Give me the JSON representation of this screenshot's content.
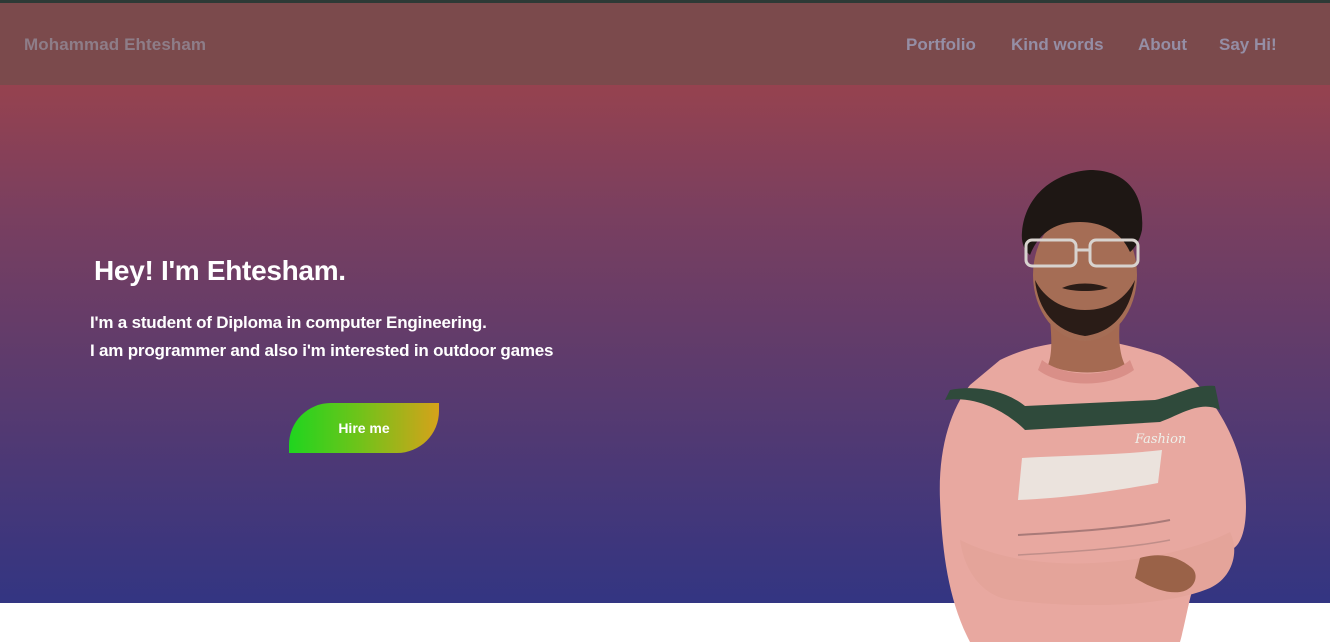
{
  "navbar": {
    "brand": "Mohammad Ehtesham",
    "links": [
      {
        "label": "Portfolio"
      },
      {
        "label": "Kind words"
      },
      {
        "label": "About"
      },
      {
        "label": "Say Hi!"
      }
    ]
  },
  "hero": {
    "headline": "Hey! I'm Ehtesham.",
    "intro_lines": [
      "I'm a student of Diploma in computer Engineering.",
      "I am programmer and also i'm interested in outdoor games"
    ],
    "cta_label": "Hire me",
    "portrait": {
      "shirt_text": "Fashion"
    }
  },
  "colors": {
    "gradient_top": "#a2434c",
    "gradient_bottom": "#333582",
    "navbar_bg": "#7b4a4c",
    "nav_text": "#958ea5",
    "button_gradient": [
      "#1fd51f",
      "#d6a21a"
    ]
  }
}
